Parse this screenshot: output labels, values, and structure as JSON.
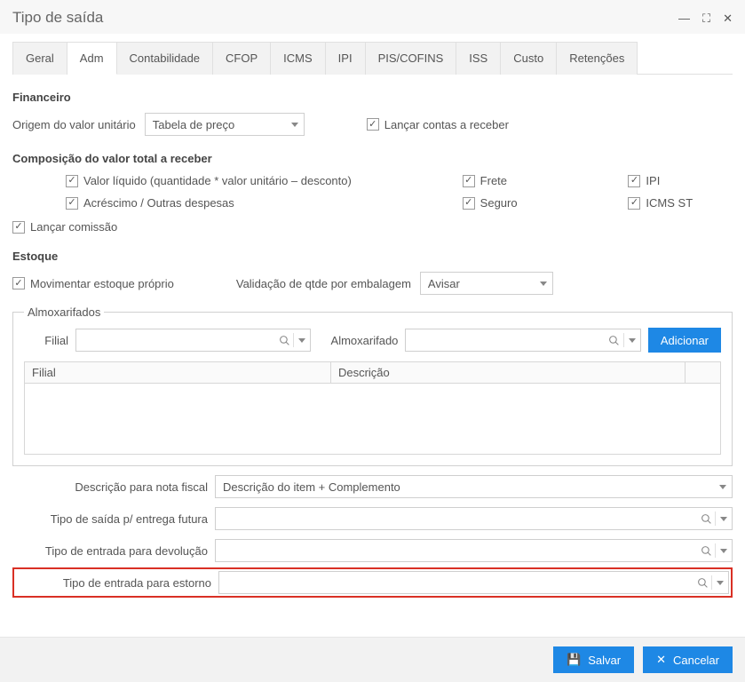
{
  "window": {
    "title": "Tipo de saída"
  },
  "tabs": [
    "Geral",
    "Adm",
    "Contabilidade",
    "CFOP",
    "ICMS",
    "IPI",
    "PIS/COFINS",
    "ISS",
    "Custo",
    "Retenções"
  ],
  "active_tab": 1,
  "sections": {
    "financeiro": "Financeiro",
    "composicao": "Composição do valor total a receber",
    "estoque": "Estoque",
    "almox": "Almoxarifados"
  },
  "financeiro": {
    "origem_label": "Origem do valor unitário",
    "origem_value": "Tabela de preço",
    "lancar_contas": "Lançar contas a receber"
  },
  "composicao": {
    "valor_liquido": "Valor líquido (quantidade * valor unitário – desconto)",
    "frete": "Frete",
    "ipi": "IPI",
    "acrescimo": "Acréscimo / Outras despesas",
    "seguro": "Seguro",
    "icms_st": "ICMS ST"
  },
  "lancar_comissao": "Lançar comissão",
  "estoque": {
    "movimentar": "Movimentar estoque próprio",
    "valid_label": "Validação de qtde por embalagem",
    "valid_value": "Avisar"
  },
  "almox": {
    "filial_label": "Filial",
    "almox_label": "Almoxarifado",
    "add_btn": "Adicionar",
    "th_filial": "Filial",
    "th_descricao": "Descrição"
  },
  "lower": {
    "desc_nf_label": "Descrição para nota fiscal",
    "desc_nf_value": "Descrição do item + Complemento",
    "saida_futura_label": "Tipo de saída p/ entrega futura",
    "entrada_devolucao_label": "Tipo de entrada para devolução",
    "entrada_estorno_label": "Tipo de entrada para estorno"
  },
  "footer": {
    "save": "Salvar",
    "cancel": "Cancelar"
  }
}
